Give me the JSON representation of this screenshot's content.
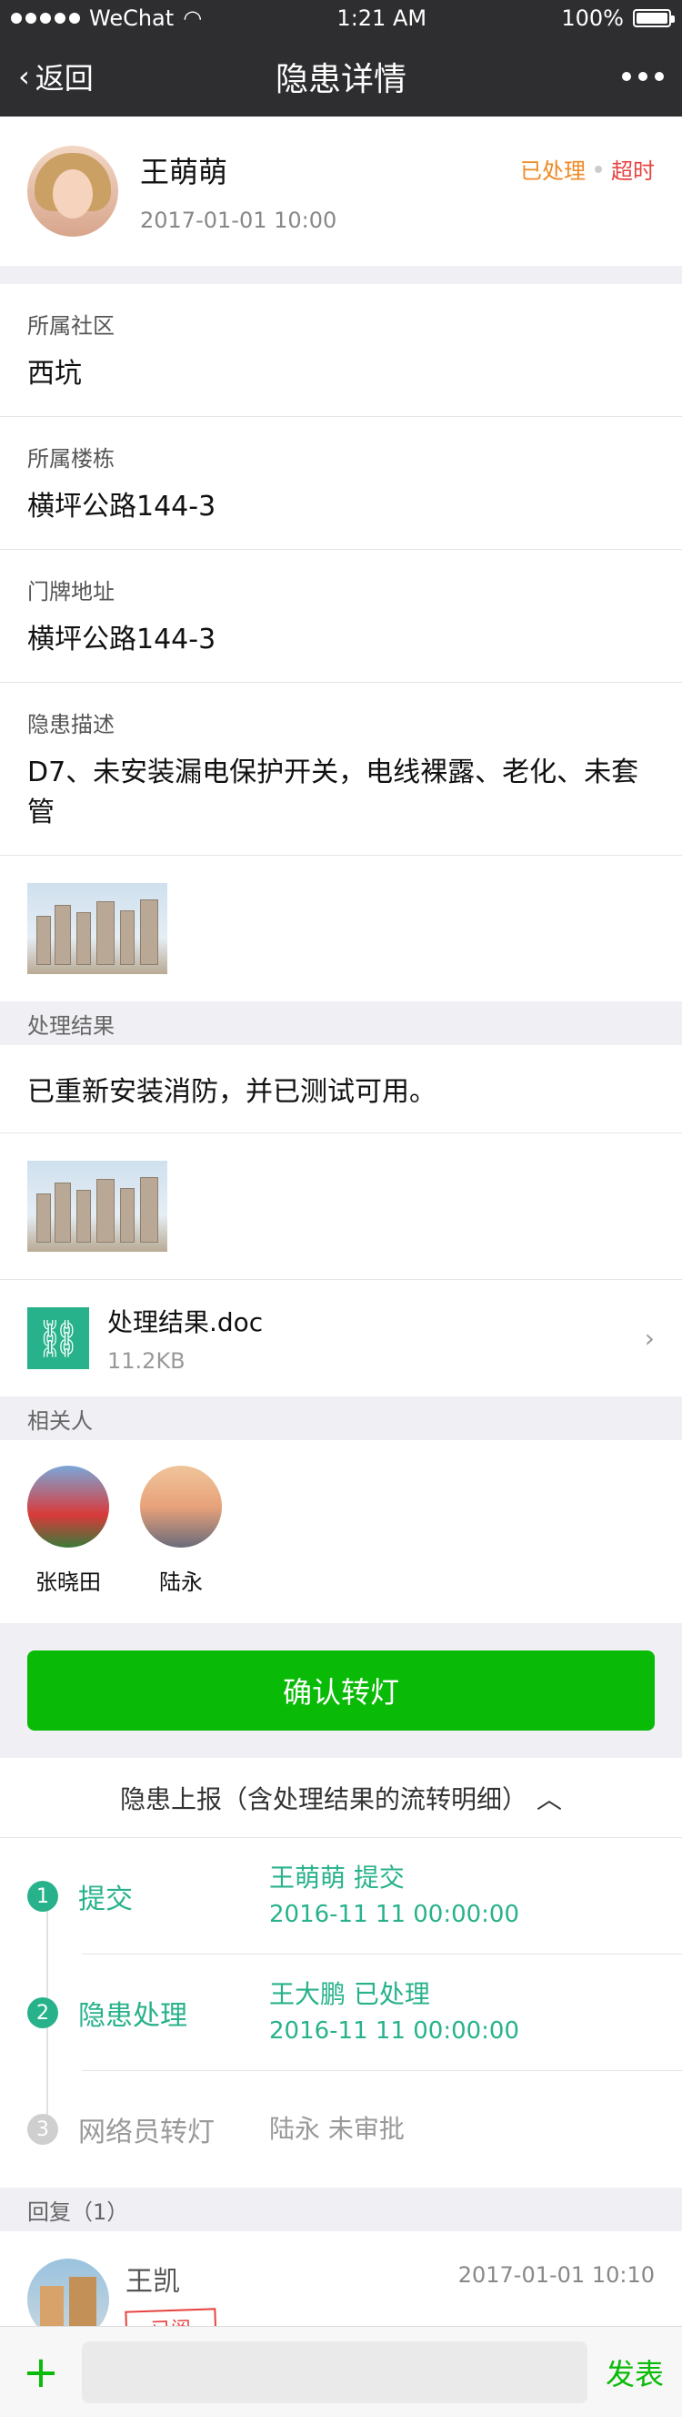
{
  "status_bar": {
    "carrier": "WeChat",
    "time": "1:21 AM",
    "battery": "100%"
  },
  "nav": {
    "back_label": "返回",
    "title": "隐患详情"
  },
  "header": {
    "user_name": "王萌萌",
    "datetime": "2017-01-01 10:00",
    "status_handled": "已处理",
    "status_overtime": "超时"
  },
  "fields": [
    {
      "label": "所属社区",
      "value": "西坑"
    },
    {
      "label": "所属楼栋",
      "value": "横坪公路144-3"
    },
    {
      "label": "门牌地址",
      "value": "横坪公路144-3"
    },
    {
      "label": "隐患描述",
      "value": "D7、未安装漏电保护开关，电线裸露、老化、未套管"
    }
  ],
  "result": {
    "section_title": "处理结果",
    "text": "已重新安装消防，并已测试可用。",
    "file_name": "处理结果.doc",
    "file_size": "11.2KB"
  },
  "related": {
    "section_title": "相关人",
    "people": [
      {
        "name": "张晓田"
      },
      {
        "name": "陆永"
      }
    ]
  },
  "confirm_button": "确认转灯",
  "flow": {
    "header": "隐患上报（含处理结果的流转明细）",
    "steps": [
      {
        "num": "1",
        "title": "提交",
        "line1": "王萌萌 提交",
        "line2": "2016-11 11 00:00:00",
        "state": "done"
      },
      {
        "num": "2",
        "title": "隐患处理",
        "line1": "王大鹏 已处理",
        "line2": "2016-11 11 00:00:00",
        "state": "done"
      },
      {
        "num": "3",
        "title": "网络员转灯",
        "line1": "陆永 未审批",
        "line2": "",
        "state": "pending"
      }
    ]
  },
  "reply": {
    "section_title": "回复（1）",
    "name": "王凯",
    "stamp": "已阅",
    "time": "2017-01-01 10:10"
  },
  "input_bar": {
    "send_label": "发表"
  },
  "colors": {
    "accent_green": "#09bb07",
    "teal": "#28b28b",
    "orange": "#f08a24",
    "red": "#e64340"
  }
}
